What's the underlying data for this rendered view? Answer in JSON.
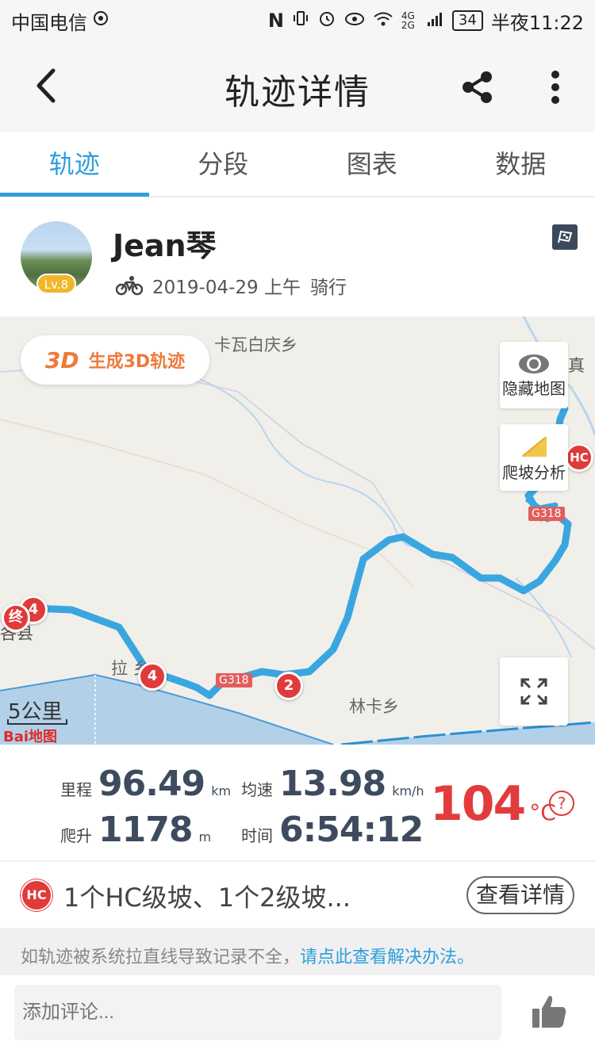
{
  "status_bar": {
    "carrier": "中国电信",
    "network": "4G 2G",
    "battery": "34",
    "time": "半夜11:22"
  },
  "header": {
    "title": "轨迹详情",
    "icons": [
      "back-arrow-icon",
      "share-icon",
      "more-vert-icon"
    ]
  },
  "tabs": [
    {
      "label": "轨迹",
      "active": true
    },
    {
      "label": "分段",
      "active": false
    },
    {
      "label": "图表",
      "active": false
    },
    {
      "label": "数据",
      "active": false
    }
  ],
  "profile": {
    "name": "Jean琴",
    "level": "Lv.8",
    "date": "2019-04-29 上午",
    "activity": "骑行"
  },
  "map": {
    "btn_3d_big": "3D",
    "btn_3d_label": "生成3D轨迹",
    "hide_map": "隐藏地图",
    "climb_analysis": "爬坡分析",
    "labels": {
      "kawa": "卡瓦白庆乡",
      "zhen": "真",
      "lali": "拉 乡",
      "linka": "林卡乡",
      "region": "各县"
    },
    "scale": "5公里",
    "logo": "Bai地图",
    "road": "G318",
    "markers": {
      "end": "终",
      "m4a": "4",
      "m4b": "4",
      "m2": "2",
      "hc": "HC"
    },
    "route_color": "#3aa6e0"
  },
  "stats": {
    "distance": {
      "label": "里程",
      "value": "96.49",
      "unit": "km"
    },
    "avg_speed": {
      "label": "均速",
      "value": "13.98",
      "unit": "km/h"
    },
    "climb": {
      "label": "爬升",
      "value": "1178",
      "unit": "m"
    },
    "time": {
      "label": "时间",
      "value": "6:54:12"
    },
    "temperature": {
      "value": "104",
      "unit": "°C"
    },
    "help": "?"
  },
  "climb_summary": {
    "badge": "HC",
    "text": "1个HC级坡、1个2级坡...",
    "button": "查看详情"
  },
  "notice": {
    "text": "如轨迹被系统拉直线导致记录不全，",
    "link": "请点此查看解决办法。"
  },
  "comment": {
    "placeholder": "添加评论..."
  }
}
